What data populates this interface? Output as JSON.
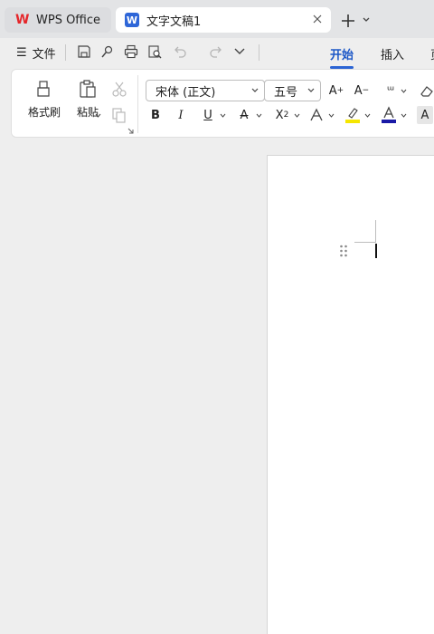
{
  "tabs": {
    "wps_label": "WPS Office",
    "doc_label": "文字文稿1"
  },
  "menu": {
    "file_label": "文件",
    "ribbon_tabs": [
      "开始",
      "插入"
    ],
    "active_tab": "开始"
  },
  "ribbon": {
    "format_painter_label": "格式刷",
    "paste_label": "粘贴",
    "font_name": "宋体 (正文)",
    "font_size": "五号"
  },
  "colors": {
    "accent": "#2b64d4",
    "highlight": "#f5e600",
    "font_color": "#1a1aa6"
  }
}
